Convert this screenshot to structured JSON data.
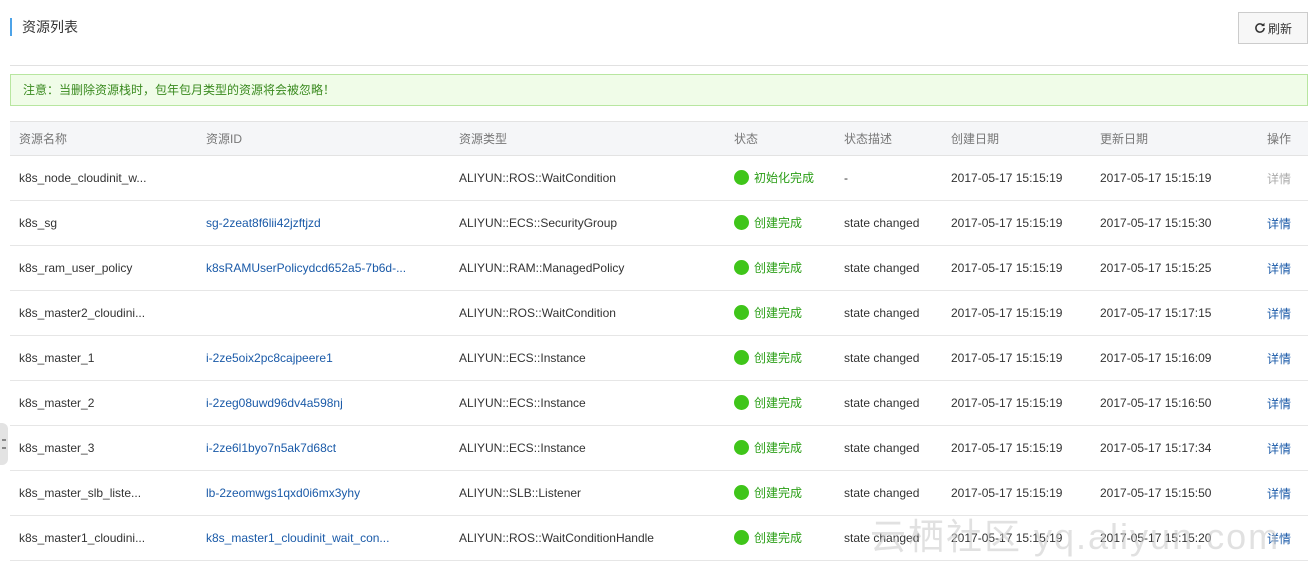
{
  "header": {
    "title": "资源列表",
    "refresh_label": "刷新"
  },
  "notice": "注意：当删除资源栈时，包年包月类型的资源将会被忽略！",
  "table": {
    "columns": [
      "资源名称",
      "资源ID",
      "资源类型",
      "状态",
      "状态描述",
      "创建日期",
      "更新日期",
      "操作"
    ],
    "rows": [
      {
        "name": "k8s_node_cloudinit_w...",
        "id": "",
        "type": "ALIYUN::ROS::WaitCondition",
        "status": "初始化完成",
        "desc": "-",
        "created": "2017-05-17 15:15:19",
        "updated": "2017-05-17 15:15:19",
        "op": "详情",
        "op_enabled": false
      },
      {
        "name": "k8s_sg",
        "id": "sg-2zeat8f6lii42jzftjzd",
        "type": "ALIYUN::ECS::SecurityGroup",
        "status": "创建完成",
        "desc": "state changed",
        "created": "2017-05-17 15:15:19",
        "updated": "2017-05-17 15:15:30",
        "op": "详情",
        "op_enabled": true
      },
      {
        "name": "k8s_ram_user_policy",
        "id": "k8sRAMUserPolicydcd652a5-7b6d-...",
        "type": "ALIYUN::RAM::ManagedPolicy",
        "status": "创建完成",
        "desc": "state changed",
        "created": "2017-05-17 15:15:19",
        "updated": "2017-05-17 15:15:25",
        "op": "详情",
        "op_enabled": true
      },
      {
        "name": "k8s_master2_cloudini...",
        "id": "",
        "type": "ALIYUN::ROS::WaitCondition",
        "status": "创建完成",
        "desc": "state changed",
        "created": "2017-05-17 15:15:19",
        "updated": "2017-05-17 15:17:15",
        "op": "详情",
        "op_enabled": true
      },
      {
        "name": "k8s_master_1",
        "id": "i-2ze5oix2pc8cajpeere1",
        "type": "ALIYUN::ECS::Instance",
        "status": "创建完成",
        "desc": "state changed",
        "created": "2017-05-17 15:15:19",
        "updated": "2017-05-17 15:16:09",
        "op": "详情",
        "op_enabled": true
      },
      {
        "name": "k8s_master_2",
        "id": "i-2zeg08uwd96dv4a598nj",
        "type": "ALIYUN::ECS::Instance",
        "status": "创建完成",
        "desc": "state changed",
        "created": "2017-05-17 15:15:19",
        "updated": "2017-05-17 15:16:50",
        "op": "详情",
        "op_enabled": true
      },
      {
        "name": "k8s_master_3",
        "id": "i-2ze6l1byo7n5ak7d68ct",
        "type": "ALIYUN::ECS::Instance",
        "status": "创建完成",
        "desc": "state changed",
        "created": "2017-05-17 15:15:19",
        "updated": "2017-05-17 15:17:34",
        "op": "详情",
        "op_enabled": true
      },
      {
        "name": "k8s_master_slb_liste...",
        "id": "lb-2zeomwgs1qxd0i6mx3yhy",
        "type": "ALIYUN::SLB::Listener",
        "status": "创建完成",
        "desc": "state changed",
        "created": "2017-05-17 15:15:19",
        "updated": "2017-05-17 15:15:50",
        "op": "详情",
        "op_enabled": true
      },
      {
        "name": "k8s_master1_cloudini...",
        "id": "k8s_master1_cloudinit_wait_con...",
        "type": "ALIYUN::ROS::WaitConditionHandle",
        "status": "创建完成",
        "desc": "state changed",
        "created": "2017-05-17 15:15:19",
        "updated": "2017-05-17 15:15:20",
        "op": "详情",
        "op_enabled": true
      }
    ]
  },
  "watermark": "云栖社区 yq.aliyun.com",
  "colors": {
    "accent": "#4da3e8",
    "link": "#1a5aa8",
    "success": "#3fc51a",
    "notice_bg": "#f0fce8"
  }
}
